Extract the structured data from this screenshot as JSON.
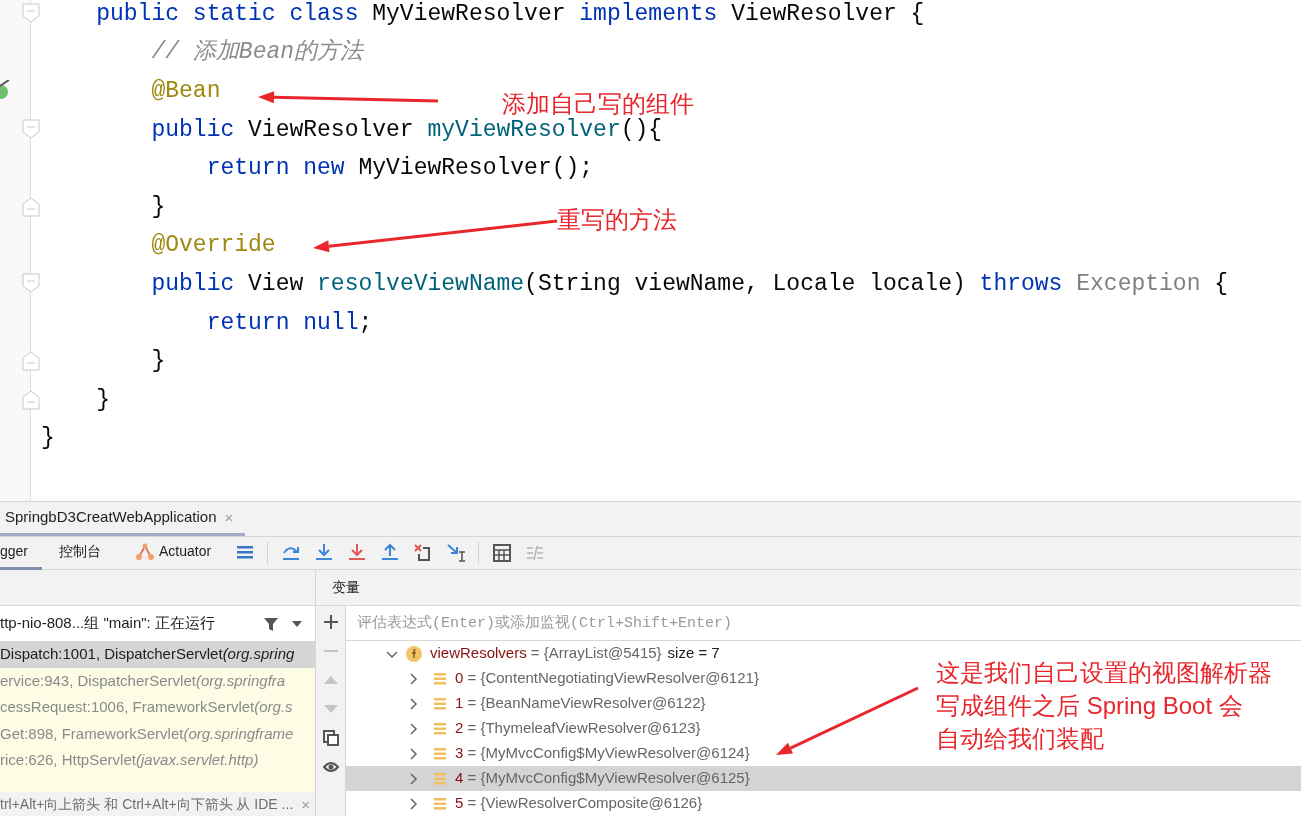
{
  "editor": {
    "lines": [
      {
        "kind": "block_start",
        "tokens": [
          {
            "kind": "keyword",
            "text": "    public static class "
          },
          {
            "kind": "plain",
            "text": "MyViewResolver "
          },
          {
            "kind": "keyword",
            "text": "implements "
          },
          {
            "kind": "plain",
            "text": "ViewResolver {"
          }
        ]
      },
      {
        "kind": "plain",
        "tokens": [
          {
            "kind": "comment",
            "text": "        // 添加Bean的方法"
          }
        ]
      },
      {
        "kind": "plain",
        "gutter_mark": true,
        "tokens": [
          {
            "kind": "annotation",
            "text": "        @Bean"
          }
        ]
      },
      {
        "kind": "block_start",
        "tokens": [
          {
            "kind": "keyword",
            "text": "        public "
          },
          {
            "kind": "plain",
            "text": "ViewResolver "
          },
          {
            "kind": "method",
            "text": "myViewResolver"
          },
          {
            "kind": "plain",
            "text": "(){"
          }
        ]
      },
      {
        "kind": "plain",
        "tokens": [
          {
            "kind": "keyword",
            "text": "            return new "
          },
          {
            "kind": "plain",
            "text": "MyViewResolver();"
          }
        ]
      },
      {
        "kind": "block_end",
        "tokens": [
          {
            "kind": "plain",
            "text": "        }"
          }
        ]
      },
      {
        "kind": "plain",
        "tokens": [
          {
            "kind": "annotation",
            "text": "        @Override"
          }
        ]
      },
      {
        "kind": "block_start",
        "tokens": [
          {
            "kind": "keyword",
            "text": "        public "
          },
          {
            "kind": "plain",
            "text": "View "
          },
          {
            "kind": "method",
            "text": "resolveViewName"
          },
          {
            "kind": "plain",
            "text": "(String viewName, Locale locale) "
          },
          {
            "kind": "keyword",
            "text": "throws "
          },
          {
            "kind": "muted",
            "text": "Exception "
          },
          {
            "kind": "plain",
            "text": "{"
          }
        ]
      },
      {
        "kind": "plain",
        "tokens": [
          {
            "kind": "keyword",
            "text": "            return null"
          },
          {
            "kind": "plain",
            "text": ";"
          }
        ]
      },
      {
        "kind": "block_end",
        "tokens": [
          {
            "kind": "plain",
            "text": "        }"
          }
        ]
      },
      {
        "kind": "block_end",
        "tokens": [
          {
            "kind": "plain",
            "text": "    }"
          }
        ]
      },
      {
        "kind": "plain",
        "tokens": [
          {
            "kind": "plain",
            "text": "}"
          }
        ]
      }
    ]
  },
  "callouts": [
    {
      "lines": [
        "添加自己写的组件"
      ]
    },
    {
      "lines": [
        "重写的方法"
      ]
    },
    {
      "lines": [
        "这是我们自己设置的视图解析器",
        "写成组件之后 Spring Boot 会",
        "自动给我们装配"
      ]
    }
  ],
  "run_tab": {
    "title": "SpringbD3CreatWebApplication",
    "close": "×"
  },
  "tool_tabs": [
    {
      "label": "gger",
      "selected": true
    },
    {
      "label": "控制台",
      "selected": false
    },
    {
      "label": "Actuator",
      "selected": false,
      "kind": "actuator"
    }
  ],
  "frames": {
    "thread": "ttp-nio-808...组 \"main\": 正在运行",
    "items": [
      {
        "location": "Dispatch:1001, DispatcherServlet ",
        "package": "(org.spring",
        "selected": true
      },
      {
        "location": "ervice:943, DispatcherServlet ",
        "package": "(org.springfra",
        "selected": false
      },
      {
        "location": "cessRequest:1006, FrameworkServlet ",
        "package": "(org.s",
        "selected": false
      },
      {
        "location": "Get:898, FrameworkServlet ",
        "package": "(org.springframe",
        "selected": false
      },
      {
        "location": "rice:626, HttpServlet ",
        "package": "(javax.servlet.http)",
        "selected": false
      }
    ],
    "hint": "trl+Alt+向上箭头 和 Ctrl+Alt+向下箭头 从 IDE ...",
    "hint_close": "×"
  },
  "variables": {
    "title": "变量",
    "placeholder": "评估表达式(Enter)或添加监视(Ctrl+Shift+Enter)",
    "root": {
      "name": "viewResolvers",
      "value": "= {ArrayList@5415}",
      "size": "size = 7",
      "expanded": true,
      "selected": false,
      "children": [
        {
          "name": "0",
          "value": "= {ContentNegotiatingViewResolver@6121}",
          "expanded": false,
          "selected": false
        },
        {
          "name": "1",
          "value": "= {BeanNameViewResolver@6122}",
          "expanded": false,
          "selected": false
        },
        {
          "name": "2",
          "value": "= {ThymeleafViewResolver@6123}",
          "expanded": false,
          "selected": false
        },
        {
          "name": "3",
          "value": "= {MyMvcConfig$MyViewResolver@6124}",
          "expanded": false,
          "selected": false
        },
        {
          "name": "4",
          "value": "= {MyMvcConfig$MyViewResolver@6125}",
          "expanded": false,
          "selected": true
        },
        {
          "name": "5",
          "value": "= {ViewResolverComposite@6126}",
          "expanded": false,
          "selected": false
        }
      ]
    }
  }
}
